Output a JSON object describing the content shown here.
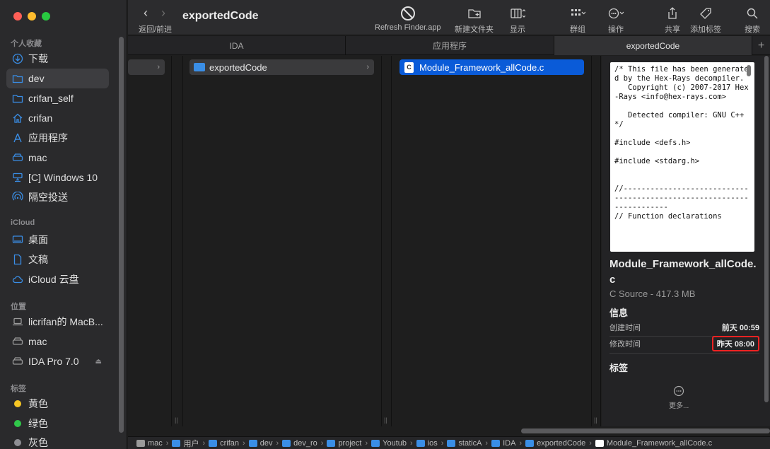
{
  "window": {
    "title": "exportedCode"
  },
  "toolbar": {
    "back_forward_label": "返回/前进",
    "refresh_label": "Refresh Finder.app",
    "new_folder_label": "新建文件夹",
    "view_label": "显示",
    "group_label": "群组",
    "action_label": "操作",
    "share_label": "共享",
    "tag_label": "添加标签",
    "search_label": "搜索"
  },
  "sidebar": {
    "favorites_title": "个人收藏",
    "favorites": [
      {
        "label": "下载",
        "icon": "download-icon"
      },
      {
        "label": "dev",
        "icon": "folder-icon",
        "selected": true
      },
      {
        "label": "crifan_self",
        "icon": "folder-icon"
      },
      {
        "label": "crifan",
        "icon": "home-icon"
      },
      {
        "label": "应用程序",
        "icon": "applications-icon"
      },
      {
        "label": "mac",
        "icon": "drive-icon"
      },
      {
        "label": "[C] Windows 10",
        "icon": "network-drive-icon"
      },
      {
        "label": "隔空投送",
        "icon": "airdrop-icon"
      }
    ],
    "icloud_title": "iCloud",
    "icloud": [
      {
        "label": "桌面",
        "icon": "desktop-icon"
      },
      {
        "label": "文稿",
        "icon": "document-icon"
      },
      {
        "label": "iCloud 云盘",
        "icon": "cloud-icon"
      }
    ],
    "locations_title": "位置",
    "locations": [
      {
        "label": "licrifan的 MacB...",
        "icon": "laptop-icon"
      },
      {
        "label": "mac",
        "icon": "drive-icon"
      },
      {
        "label": "IDA Pro 7.0",
        "icon": "drive-icon",
        "eject": "⏏"
      }
    ],
    "tags_title": "标签",
    "tags": [
      {
        "label": "黄色",
        "color": "#f6c624"
      },
      {
        "label": "绿色",
        "color": "#30c84a"
      },
      {
        "label": "灰色",
        "color": "#8e8e93"
      }
    ]
  },
  "tabs": [
    {
      "label": "IDA"
    },
    {
      "label": "应用程序"
    },
    {
      "label": "exportedCode",
      "active": true
    }
  ],
  "columns": {
    "col2_item": "exportedCode",
    "col3_item": "Module_Framework_allCode.c"
  },
  "preview": {
    "code": "/* This file has been generated by the Hex-Rays decompiler.\n   Copyright (c) 2007-2017 Hex-Rays <info@hex-rays.com>\n\n   Detected compiler: GNU C++\n*/\n\n#include <defs.h>\n\n#include <stdarg.h>\n\n\n//----------------------------------------------------------------------\n// Function declarations",
    "file_name": "Module_Framework_allCode.c",
    "kind": "C Source - 417.3 MB",
    "info_title": "信息",
    "created_label": "创建时间",
    "created_value": "前天 00:59",
    "modified_label": "修改时间",
    "modified_value": "昨天 08:00",
    "tags_title": "标签",
    "more_label": "更多..."
  },
  "pathbar": {
    "crumbs": [
      "mac",
      "用户",
      "crifan",
      "dev",
      "dev_ro",
      "project",
      "Youtub",
      "ios",
      "staticA",
      "IDA",
      "exportedCode",
      "Module_Framework_allCode.c"
    ]
  },
  "colors": {
    "accent": "#0a5bd8",
    "highlight_border": "#e22222"
  }
}
